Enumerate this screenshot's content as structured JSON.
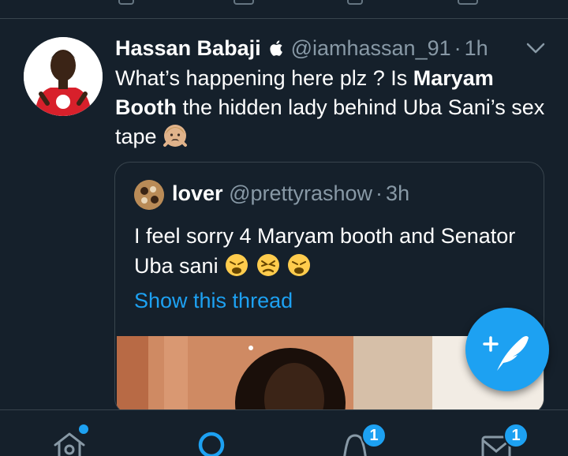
{
  "tweet": {
    "name": "Hassan Babaji",
    "handle": "@iamhassan_91",
    "separator": "·",
    "time": "1h",
    "text_1": "What’s happening here plz ? Is ",
    "text_bold_1": "Maryam Booth",
    "text_2": " the hidden lady behind Uba Sani’s sex tape",
    "avatar_name": "avatar",
    "badge_icon": "apple-icon",
    "emoji_icon": "person-gesturing-no-emoji"
  },
  "quote": {
    "name": "lover",
    "handle": "@prettyrashow",
    "separator": "·",
    "time": "3h",
    "text": "I feel sorry 4 Maryam booth and Senator Uba sani",
    "link": "Show this thread",
    "emoji_icon": "weary-face-emoji"
  },
  "bottom_nav": {
    "items": [
      {
        "icon": "home-icon"
      },
      {
        "icon": "search-icon"
      },
      {
        "icon": "bell-icon",
        "badge": "1"
      },
      {
        "icon": "mail-icon",
        "badge": "1"
      }
    ]
  },
  "fab": {
    "icon": "compose-tweet-icon"
  },
  "colors": {
    "background": "#15202b",
    "accent": "#1da1f2",
    "secondary_text": "#8899a6",
    "border": "#38444d"
  }
}
